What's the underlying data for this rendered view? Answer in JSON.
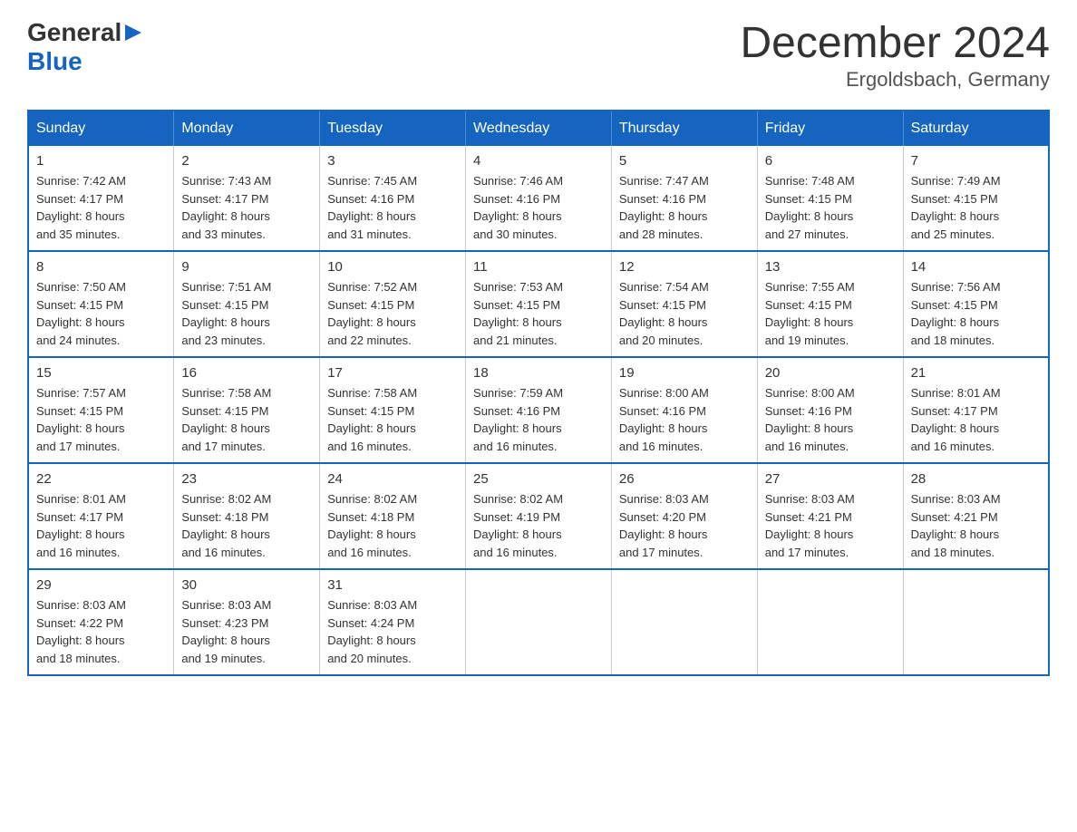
{
  "logo": {
    "general": "General",
    "blue": "Blue",
    "triangle": "▶"
  },
  "title": "December 2024",
  "subtitle": "Ergoldsbach, Germany",
  "headers": [
    "Sunday",
    "Monday",
    "Tuesday",
    "Wednesday",
    "Thursday",
    "Friday",
    "Saturday"
  ],
  "weeks": [
    [
      {
        "day": "1",
        "sunrise": "7:42 AM",
        "sunset": "4:17 PM",
        "daylight": "8 hours and 35 minutes."
      },
      {
        "day": "2",
        "sunrise": "7:43 AM",
        "sunset": "4:17 PM",
        "daylight": "8 hours and 33 minutes."
      },
      {
        "day": "3",
        "sunrise": "7:45 AM",
        "sunset": "4:16 PM",
        "daylight": "8 hours and 31 minutes."
      },
      {
        "day": "4",
        "sunrise": "7:46 AM",
        "sunset": "4:16 PM",
        "daylight": "8 hours and 30 minutes."
      },
      {
        "day": "5",
        "sunrise": "7:47 AM",
        "sunset": "4:16 PM",
        "daylight": "8 hours and 28 minutes."
      },
      {
        "day": "6",
        "sunrise": "7:48 AM",
        "sunset": "4:15 PM",
        "daylight": "8 hours and 27 minutes."
      },
      {
        "day": "7",
        "sunrise": "7:49 AM",
        "sunset": "4:15 PM",
        "daylight": "8 hours and 25 minutes."
      }
    ],
    [
      {
        "day": "8",
        "sunrise": "7:50 AM",
        "sunset": "4:15 PM",
        "daylight": "8 hours and 24 minutes."
      },
      {
        "day": "9",
        "sunrise": "7:51 AM",
        "sunset": "4:15 PM",
        "daylight": "8 hours and 23 minutes."
      },
      {
        "day": "10",
        "sunrise": "7:52 AM",
        "sunset": "4:15 PM",
        "daylight": "8 hours and 22 minutes."
      },
      {
        "day": "11",
        "sunrise": "7:53 AM",
        "sunset": "4:15 PM",
        "daylight": "8 hours and 21 minutes."
      },
      {
        "day": "12",
        "sunrise": "7:54 AM",
        "sunset": "4:15 PM",
        "daylight": "8 hours and 20 minutes."
      },
      {
        "day": "13",
        "sunrise": "7:55 AM",
        "sunset": "4:15 PM",
        "daylight": "8 hours and 19 minutes."
      },
      {
        "day": "14",
        "sunrise": "7:56 AM",
        "sunset": "4:15 PM",
        "daylight": "8 hours and 18 minutes."
      }
    ],
    [
      {
        "day": "15",
        "sunrise": "7:57 AM",
        "sunset": "4:15 PM",
        "daylight": "8 hours and 17 minutes."
      },
      {
        "day": "16",
        "sunrise": "7:58 AM",
        "sunset": "4:15 PM",
        "daylight": "8 hours and 17 minutes."
      },
      {
        "day": "17",
        "sunrise": "7:58 AM",
        "sunset": "4:15 PM",
        "daylight": "8 hours and 16 minutes."
      },
      {
        "day": "18",
        "sunrise": "7:59 AM",
        "sunset": "4:16 PM",
        "daylight": "8 hours and 16 minutes."
      },
      {
        "day": "19",
        "sunrise": "8:00 AM",
        "sunset": "4:16 PM",
        "daylight": "8 hours and 16 minutes."
      },
      {
        "day": "20",
        "sunrise": "8:00 AM",
        "sunset": "4:16 PM",
        "daylight": "8 hours and 16 minutes."
      },
      {
        "day": "21",
        "sunrise": "8:01 AM",
        "sunset": "4:17 PM",
        "daylight": "8 hours and 16 minutes."
      }
    ],
    [
      {
        "day": "22",
        "sunrise": "8:01 AM",
        "sunset": "4:17 PM",
        "daylight": "8 hours and 16 minutes."
      },
      {
        "day": "23",
        "sunrise": "8:02 AM",
        "sunset": "4:18 PM",
        "daylight": "8 hours and 16 minutes."
      },
      {
        "day": "24",
        "sunrise": "8:02 AM",
        "sunset": "4:18 PM",
        "daylight": "8 hours and 16 minutes."
      },
      {
        "day": "25",
        "sunrise": "8:02 AM",
        "sunset": "4:19 PM",
        "daylight": "8 hours and 16 minutes."
      },
      {
        "day": "26",
        "sunrise": "8:03 AM",
        "sunset": "4:20 PM",
        "daylight": "8 hours and 17 minutes."
      },
      {
        "day": "27",
        "sunrise": "8:03 AM",
        "sunset": "4:21 PM",
        "daylight": "8 hours and 17 minutes."
      },
      {
        "day": "28",
        "sunrise": "8:03 AM",
        "sunset": "4:21 PM",
        "daylight": "8 hours and 18 minutes."
      }
    ],
    [
      {
        "day": "29",
        "sunrise": "8:03 AM",
        "sunset": "4:22 PM",
        "daylight": "8 hours and 18 minutes."
      },
      {
        "day": "30",
        "sunrise": "8:03 AM",
        "sunset": "4:23 PM",
        "daylight": "8 hours and 19 minutes."
      },
      {
        "day": "31",
        "sunrise": "8:03 AM",
        "sunset": "4:24 PM",
        "daylight": "8 hours and 20 minutes."
      },
      null,
      null,
      null,
      null
    ]
  ],
  "labels": {
    "sunrise": "Sunrise:",
    "sunset": "Sunset:",
    "daylight": "Daylight:"
  }
}
